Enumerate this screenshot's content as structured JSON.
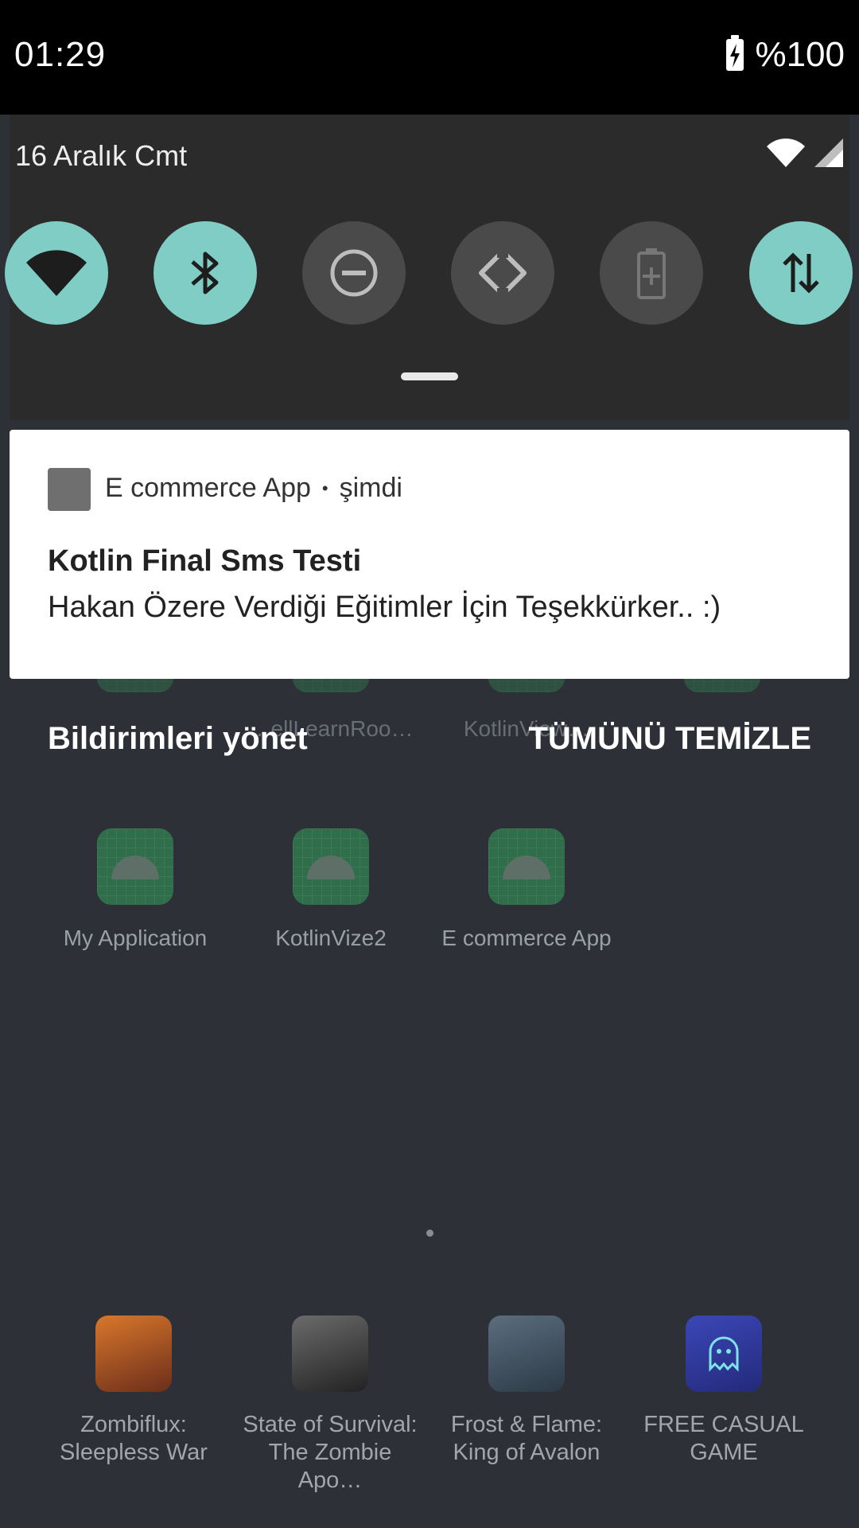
{
  "status_bar": {
    "time": "01:29",
    "battery": "%100"
  },
  "quick_settings": {
    "date": "16 Aralık Cmt",
    "tiles": [
      {
        "name": "wifi",
        "state": "on"
      },
      {
        "name": "bluetooth",
        "state": "on"
      },
      {
        "name": "do-not-disturb",
        "state": "off"
      },
      {
        "name": "auto-rotate",
        "state": "off"
      },
      {
        "name": "battery-saver",
        "state": "off"
      },
      {
        "name": "mobile-data",
        "state": "on"
      }
    ]
  },
  "notification": {
    "app_name": "E commerce App",
    "separator": "•",
    "time": "şimdi",
    "title": "Kotlin Final Sms Testi",
    "text": "Hakan Özere Verdiği Eğitimler İçin Teşekkürker.. :)"
  },
  "footer": {
    "manage_label": "Bildirimleri yönet",
    "clear_all_label": "TÜMÜNÜ TEMİZLE"
  },
  "launcher": {
    "row1_labels": [
      "",
      "…ellLearnRoo…",
      "KotlinView…",
      ""
    ],
    "apps": [
      "My Application",
      "KotlinVize2",
      "E commerce App"
    ],
    "dock": [
      {
        "line1": "Zombiflux:",
        "line2": "Sleepless War"
      },
      {
        "line1": "State of Survival:",
        "line2": "The Zombie Apo…"
      },
      {
        "line1": "Frost & Flame:",
        "line2": "King of Avalon"
      },
      {
        "line1": "FREE CASUAL",
        "line2": "GAME"
      }
    ]
  },
  "colors": {
    "tile_on": "#7fcdc4",
    "tile_off": "#4a4a4a",
    "panel": "#2b2b2b",
    "background": "#2d3037"
  }
}
